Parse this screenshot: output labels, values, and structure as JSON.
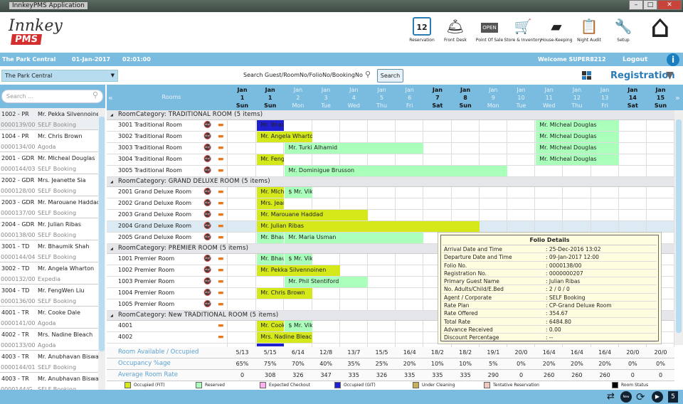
{
  "app": {
    "title": "InnkeyPMS Application",
    "logo_text": "Innkey PMS"
  },
  "toolbar": [
    {
      "label": "Reservation",
      "icon": "calendar-icon",
      "glyph": "12"
    },
    {
      "label": "Front Desk",
      "icon": "bell-icon",
      "glyph": "🛎"
    },
    {
      "label": "Point Of Sale",
      "icon": "open-sign-icon",
      "glyph": "OPEN"
    },
    {
      "label": "Store & Inventory",
      "icon": "cart-icon",
      "glyph": "🛒"
    },
    {
      "label": "House-Keeping",
      "icon": "wallet-icon",
      "glyph": "▰"
    },
    {
      "label": "Night Audit",
      "icon": "checklist-icon",
      "glyph": "📋"
    },
    {
      "label": "Setup",
      "icon": "tools-icon",
      "glyph": "🔧"
    },
    {
      "label": "",
      "icon": "home-icon",
      "glyph": "⌂"
    }
  ],
  "infobar": {
    "property": "The Park Central",
    "date": "01-Jan-2017",
    "time": "02:01:00",
    "welcome": "Welcome SUPER8212",
    "logout": "Logout"
  },
  "controls": {
    "property_select": "The Park Central",
    "search_label": "Search Guest/RoomNo/FolioNo/BookingNo",
    "search_button": "Search",
    "registration": "Registration"
  },
  "left": {
    "search_placeholder": "Search ...",
    "items": [
      {
        "room": "1002 - PR",
        "guest": "Mr. Pekka Silvennoinen",
        "folio": "0000139/00",
        "agent": "SELF Booking"
      },
      {
        "room": "1004 - PR",
        "guest": "Mr. Chris Brown",
        "folio": "0000134/00",
        "agent": "Agoda"
      },
      {
        "room": "2001 - GDR",
        "guest": "Mr. MIcheal Douglas",
        "folio": "0000144/03",
        "agent": "SELF Booking"
      },
      {
        "room": "2002 - GDR",
        "guest": "Mrs. Jeanette Sia",
        "folio": "0000128/00",
        "agent": "SELF Booking"
      },
      {
        "room": "2003 - GDR",
        "guest": "Mr. Marouane Haddad",
        "folio": "0000137/00",
        "agent": "SELF Booking"
      },
      {
        "room": "2004 - GDR",
        "guest": "Mr. Julian Ribas",
        "folio": "0000138/00",
        "agent": "SELF Booking"
      },
      {
        "room": "3001 - TD",
        "guest": "Mr. Bhaumik Shah",
        "folio": "0000144/04",
        "agent": "SELF Booking"
      },
      {
        "room": "3002 - TD",
        "guest": "Mr. Angela Wharton",
        "folio": "0000132/00",
        "agent": "Expedia"
      },
      {
        "room": "3004 - TD",
        "guest": "Mr. FengWen Liu",
        "folio": "0000136/00",
        "agent": "SELF Booking"
      },
      {
        "room": "4001 - TR",
        "guest": "Mr. Cooke Dale",
        "folio": "0000141/00",
        "agent": "Agoda"
      },
      {
        "room": "4002 - TR",
        "guest": "Mrs. Nadine Bleach",
        "folio": "0000133/00",
        "agent": "Agoda"
      },
      {
        "room": "4003 - TR",
        "guest": "Mr. Anubhavan Biswami",
        "folio": "0000144/01",
        "agent": "SELF Booking"
      },
      {
        "room": "4003 - TR",
        "guest": "Mr. Anubhavan Biswami",
        "folio": "0000144/G",
        "agent": "SELF Booking"
      }
    ]
  },
  "grid": {
    "rooms_header": "Rooms",
    "prev": "«",
    "next": "»",
    "dates": [
      {
        "m": "Jan",
        "d": "1",
        "w": "Sun",
        "bold": true
      },
      {
        "m": "Jan",
        "d": "1",
        "w": "Sun",
        "bold": true
      },
      {
        "m": "Jan",
        "d": "2",
        "w": "Mon"
      },
      {
        "m": "Jan",
        "d": "3",
        "w": "Tue"
      },
      {
        "m": "Jan",
        "d": "4",
        "w": "Wed"
      },
      {
        "m": "Jan",
        "d": "5",
        "w": "Thu"
      },
      {
        "m": "Jan",
        "d": "6",
        "w": "Fri"
      },
      {
        "m": "Jan",
        "d": "7",
        "w": "Sat",
        "bold": true
      },
      {
        "m": "Jan",
        "d": "8",
        "w": "Sun",
        "bold": true
      },
      {
        "m": "Jan",
        "d": "9",
        "w": "Mon"
      },
      {
        "m": "Jan",
        "d": "10",
        "w": "Tue"
      },
      {
        "m": "Jan",
        "d": "11",
        "w": "Wed"
      },
      {
        "m": "Jan",
        "d": "12",
        "w": "Thu"
      },
      {
        "m": "Jan",
        "d": "13",
        "w": "Fri"
      },
      {
        "m": "Jan",
        "d": "14",
        "w": "Sat",
        "bold": true
      },
      {
        "m": "Jan",
        "d": "15",
        "w": "Sun",
        "bold": true
      }
    ],
    "categories": [
      {
        "label": "RoomCategory: TRADITIONAL ROOM (5 items)",
        "rooms": [
          {
            "name": "3001 Traditional Room",
            "bookings": [
              {
                "guest": "Mr. Bhaumik Shah",
                "start": 1,
                "span": 1,
                "status": "git"
              },
              {
                "guest": "Mr. MIcheal Douglas",
                "start": 11,
                "span": 3,
                "status": "reserved"
              }
            ]
          },
          {
            "name": "3002 Traditional Room",
            "bookings": [
              {
                "guest": "Mr. Angela Wharton",
                "start": 1,
                "span": 2,
                "status": "fit"
              },
              {
                "guest": "Mr. MIcheal Douglas",
                "start": 11,
                "span": 3,
                "status": "reserved"
              }
            ]
          },
          {
            "name": "3003 Traditional Room",
            "bookings": [
              {
                "guest": "Mr. Turki Alhamid",
                "start": 2,
                "span": 5,
                "status": "reserved"
              },
              {
                "guest": "Mr. MIcheal Douglas",
                "start": 11,
                "span": 3,
                "status": "reserved"
              }
            ]
          },
          {
            "name": "3004 Traditional Room",
            "bookings": [
              {
                "guest": "Mr. FengWen Liu",
                "start": 1,
                "span": 1,
                "status": "fit"
              },
              {
                "guest": "Mr. MIcheal Douglas",
                "start": 11,
                "span": 3,
                "status": "reserved"
              }
            ]
          },
          {
            "name": "3005 Traditional Room",
            "bookings": [
              {
                "guest": "Mr. Dominigue Brusson",
                "start": 2,
                "span": 8,
                "status": "reserved"
              }
            ]
          }
        ]
      },
      {
        "label": "RoomCategory: GRAND DELUXE ROOM (5 items)",
        "rooms": [
          {
            "name": "2001 Grand Deluxe Room",
            "bookings": [
              {
                "guest": "Mr. MIcheal Douglas",
                "start": 1,
                "span": 1,
                "status": "fit"
              },
              {
                "guest": "$ Mr. Vikas",
                "start": 2,
                "span": 1,
                "status": "reserved"
              }
            ]
          },
          {
            "name": "2002 Grand Deluxe Room",
            "bookings": [
              {
                "guest": "Mrs. Jeanette Sia",
                "start": 1,
                "span": 1,
                "status": "fit"
              }
            ]
          },
          {
            "name": "2003 Grand Deluxe Room",
            "bookings": [
              {
                "guest": "Mr. Marouane Haddad",
                "start": 1,
                "span": 4,
                "status": "fit"
              }
            ]
          },
          {
            "name": "2004 Grand Deluxe Room",
            "selected": true,
            "bookings": [
              {
                "guest": "Mr. Julian Ribas",
                "start": 1,
                "span": 8,
                "status": "fit"
              }
            ]
          },
          {
            "name": "2005 Grand Deluxe Room",
            "bookings": [
              {
                "guest": "Mr. Bhaumik Shah",
                "start": 1,
                "span": 1,
                "status": "reserved"
              },
              {
                "guest": "Mr. Maria Usman",
                "start": 2,
                "span": 5,
                "status": "reserved"
              }
            ]
          }
        ]
      },
      {
        "label": "RoomCategory: PREMIER ROOM (5 items)",
        "rooms": [
          {
            "name": "1001 Premier Room",
            "bookings": [
              {
                "guest": "Mr. Bhaumik Shah",
                "start": 1,
                "span": 1,
                "status": "reserved"
              },
              {
                "guest": "$ Mr. Vikas",
                "start": 2,
                "span": 1,
                "status": "reserved"
              }
            ]
          },
          {
            "name": "1002 Premier Room",
            "bookings": [
              {
                "guest": "Mr. Pekka Silvennoinen",
                "start": 1,
                "span": 3,
                "status": "fit"
              }
            ]
          },
          {
            "name": "1003 Premier Room",
            "bookings": [
              {
                "guest": "Mr. Phil Stentiford",
                "start": 2,
                "span": 3,
                "status": "reserved"
              }
            ]
          },
          {
            "name": "1004 Premier Room",
            "bookings": [
              {
                "guest": "Mr. Chris Brown",
                "start": 1,
                "span": 2,
                "status": "fit"
              }
            ]
          },
          {
            "name": "1005 Premier Room",
            "bookings": []
          }
        ]
      },
      {
        "label": "RoomCategory: New TRADITIONAL ROOM (5 items)",
        "rooms": [
          {
            "name": "4001",
            "nosmoke": false,
            "bookings": [
              {
                "guest": "Mr. Cooke Dale",
                "start": 1,
                "span": 1,
                "status": "fit"
              },
              {
                "guest": "$ Mr. Vikas",
                "start": 2,
                "span": 1,
                "status": "reserved"
              }
            ]
          },
          {
            "name": "4002",
            "nosmoke": false,
            "bookings": [
              {
                "guest": "Mrs. Nadine Bleach",
                "start": 1,
                "span": 2,
                "status": "fit"
              }
            ]
          },
          {
            "name": "",
            "nosmoke": false,
            "bookings": [
              {
                "guest": "",
                "start": 1,
                "span": 1,
                "status": "git"
              }
            ]
          }
        ]
      }
    ]
  },
  "summary": [
    {
      "label": "Room Available / Occupied",
      "values": [
        "5/13",
        "5/15",
        "6/14",
        "12/8",
        "13/7",
        "15/5",
        "16/4",
        "18/2",
        "18/2",
        "19/1",
        "20/0",
        "16/4",
        "16/4",
        "16/4",
        "20/0",
        "20/0"
      ]
    },
    {
      "label": "Occupancy %age",
      "values": [
        "65%",
        "75%",
        "70%",
        "40%",
        "35%",
        "25%",
        "20%",
        "10%",
        "10%",
        "5%",
        "0%",
        "20%",
        "20%",
        "20%",
        "0%",
        "0%"
      ]
    },
    {
      "label": "Average Room Rate",
      "values": [
        "0",
        "308",
        "326",
        "347",
        "335",
        "326",
        "335",
        "335",
        "335",
        "290",
        "0",
        "260",
        "260",
        "260",
        "0",
        "0"
      ]
    }
  ],
  "legend": [
    {
      "label": "Occupied (FIT)",
      "color": "#d4e81a"
    },
    {
      "label": "Reserved",
      "color": "#aaffbb"
    },
    {
      "label": "Expected Checkout",
      "color": "#ffb0f0"
    },
    {
      "label": "Occupied (GIT)",
      "color": "#2020d0"
    },
    {
      "label": "Under Cleaning",
      "color": "#c8b058"
    },
    {
      "label": "Tentative Reservation",
      "color": "#f0c8c0"
    },
    {
      "label": "Room Status",
      "color": "#000000"
    }
  ],
  "status_colors": {
    "fit": "#d4e81a",
    "reserved": "#aaffbb",
    "git": "#2020d0"
  },
  "tooltip": {
    "title": "Folio Details",
    "rows": [
      {
        "k": "Arrival Date and Time",
        "v": ": 25-Dec-2016 13:02"
      },
      {
        "k": "Departure Date and Time",
        "v": ": 09-Jan-2017 12:00"
      },
      {
        "k": "Folio No.",
        "v": ": 0000138/00"
      },
      {
        "k": "Registration No.",
        "v": ": 0000000207"
      },
      {
        "k": "Primary Guest Name",
        "v": ": Julian Ribas"
      },
      {
        "k": "No. Adults/Child/E.Bed",
        "v": ": 2 / 0 / 0"
      },
      {
        "k": "Agent / Corporate",
        "v": ": SELF Booking"
      },
      {
        "k": "Rate Plan",
        "v": ": CP-Grand Deluxe Room"
      },
      {
        "k": "Rate Offered",
        "v": ": 354.67"
      },
      {
        "k": "Total Rate",
        "v": ": 6484.80"
      },
      {
        "k": "Advance Received",
        "v": ": 0.00"
      },
      {
        "k": "Discount Percentage",
        "v": ": --"
      }
    ]
  }
}
